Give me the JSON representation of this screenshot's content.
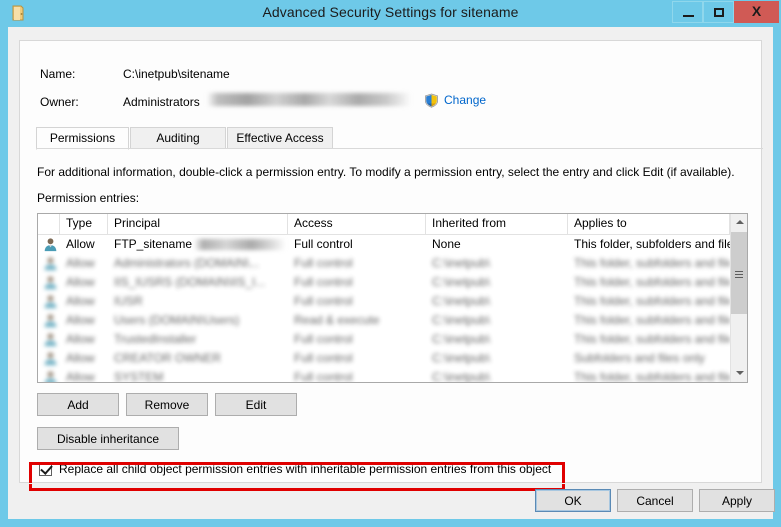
{
  "window": {
    "title": "Advanced Security Settings for sitename",
    "icon": "folder-icon",
    "controls": {
      "minimize": "–",
      "maximize": "□",
      "close": "X"
    },
    "colors": {
      "titlebar": "#6ec9e8",
      "close_button": "#d05a55",
      "dialog_background": "#f0f0f0",
      "panel_background": "#fdfdfd",
      "link": "#0066cc",
      "annotation": "#e00000"
    }
  },
  "header": {
    "name_label": "Name:",
    "name_value": "C:\\inetpub\\sitename",
    "owner_label": "Owner:",
    "owner_value": "Administrators",
    "change_link": "Change"
  },
  "tabs": [
    {
      "label": "Permissions",
      "active": true
    },
    {
      "label": "Auditing",
      "active": false
    },
    {
      "label": "Effective Access",
      "active": false
    }
  ],
  "main": {
    "info_text": "For additional information, double-click a permission entry. To modify a permission entry, select the entry and click Edit (if available).",
    "entries_label": "Permission entries:"
  },
  "table": {
    "columns": [
      "",
      "Type",
      "Principal",
      "Access",
      "Inherited from",
      "Applies to"
    ],
    "rows": [
      {
        "icon": "user-icon",
        "type": "Allow",
        "principal": "FTP_sitename",
        "access": "Full control",
        "inherited_from": "None",
        "applies_to": "This folder, subfolders and files",
        "blurred": false,
        "principal_redacted": true
      },
      {
        "icon": "user-icon",
        "type": "Allow",
        "principal": "Administrators (DOMAIN\\...",
        "access": "Full control",
        "inherited_from": "C:\\inetpub\\",
        "applies_to": "This folder, subfolders and files",
        "blurred": true,
        "principal_redacted": false
      },
      {
        "icon": "user-icon",
        "type": "Allow",
        "principal": "IIS_IUSRS (DOMAIN\\IIS_I...",
        "access": "Full control",
        "inherited_from": "C:\\inetpub\\",
        "applies_to": "This folder, subfolders and files",
        "blurred": true,
        "principal_redacted": false
      },
      {
        "icon": "user-icon",
        "type": "Allow",
        "principal": "IUSR",
        "access": "Full control",
        "inherited_from": "C:\\inetpub\\",
        "applies_to": "This folder, subfolders and files",
        "blurred": true,
        "principal_redacted": false
      },
      {
        "icon": "user-icon",
        "type": "Allow",
        "principal": "Users (DOMAIN\\Users)",
        "access": "Read & execute",
        "inherited_from": "C:\\inetpub\\",
        "applies_to": "This folder, subfolders and files",
        "blurred": true,
        "principal_redacted": false
      },
      {
        "icon": "user-icon",
        "type": "Allow",
        "principal": "TrustedInstaller",
        "access": "Full control",
        "inherited_from": "C:\\inetpub\\",
        "applies_to": "This folder, subfolders and files",
        "blurred": true,
        "principal_redacted": false
      },
      {
        "icon": "user-icon",
        "type": "Allow",
        "principal": "CREATOR OWNER",
        "access": "Full control",
        "inherited_from": "C:\\inetpub\\",
        "applies_to": "Subfolders and files only",
        "blurred": true,
        "principal_redacted": false
      },
      {
        "icon": "user-icon",
        "type": "Allow",
        "principal": "SYSTEM",
        "access": "Full control",
        "inherited_from": "C:\\inetpub\\",
        "applies_to": "This folder, subfolders and files",
        "blurred": true,
        "principal_redacted": false
      }
    ]
  },
  "actions": {
    "add": "Add",
    "remove": "Remove",
    "edit": "Edit",
    "disable_inheritance": "Disable inheritance"
  },
  "replace_option": {
    "label": "Replace all child object permission entries with inheritable permission entries from this object",
    "checked": true
  },
  "footer": {
    "ok": "OK",
    "cancel": "Cancel",
    "apply": "Apply"
  }
}
